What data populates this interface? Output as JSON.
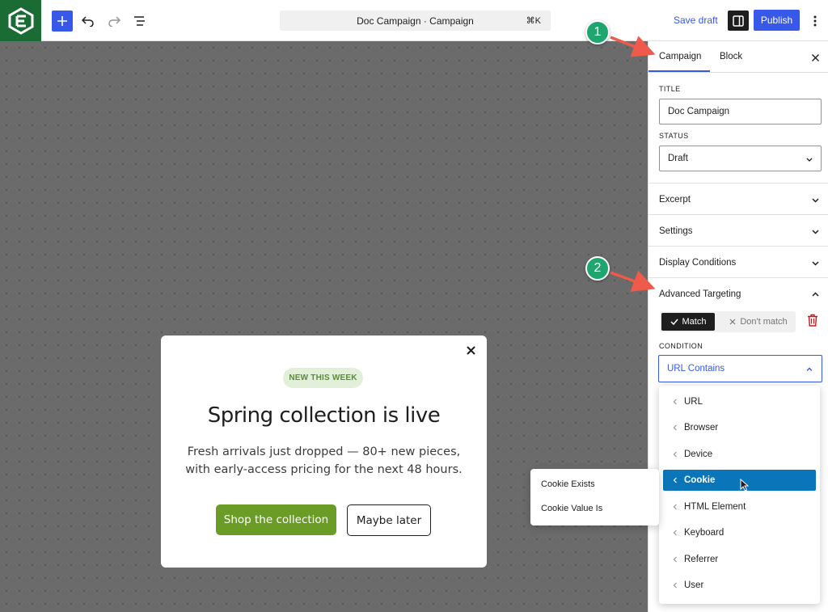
{
  "topbar": {
    "document_title": "Doc Campaign · Campaign",
    "shortcut": "⌘K",
    "save_draft_label": "Save draft",
    "publish_label": "Publish"
  },
  "popup": {
    "badge": "NEW THIS WEEK",
    "title": "Spring collection is live",
    "text": "Fresh arrivals just dropped — 80+ new pieces, with early-access pricing for the next 48 hours.",
    "primary_label": "Shop the collection",
    "secondary_label": "Maybe later"
  },
  "sidebar": {
    "tabs": [
      {
        "label": "Campaign",
        "active": true
      },
      {
        "label": "Block",
        "active": false
      }
    ],
    "title_label": "TITLE",
    "title_value": "Doc Campaign",
    "status_label": "STATUS",
    "status_value": "Draft",
    "panels": [
      "Excerpt",
      "Settings",
      "Display Conditions",
      "Advanced Targeting"
    ],
    "match_label": "Match",
    "dont_match_label": "Don't match",
    "condition_label": "CONDITION",
    "condition_value": "URL Contains"
  },
  "dropdown": {
    "items": [
      "URL",
      "Browser",
      "Device",
      "Cookie",
      "HTML Element",
      "Keyboard",
      "Referrer",
      "User"
    ],
    "active_index": 3
  },
  "submenu": {
    "items": [
      "Cookie Exists",
      "Cookie Value Is"
    ]
  },
  "callouts": [
    "1",
    "2"
  ],
  "colors": {
    "accent": "#3858e9",
    "brand": "#1a6b34",
    "highlight": "#0a75b8",
    "callout": "#1ea66e",
    "arrow": "#f05a4a",
    "popup_button": "#6a9c26"
  }
}
